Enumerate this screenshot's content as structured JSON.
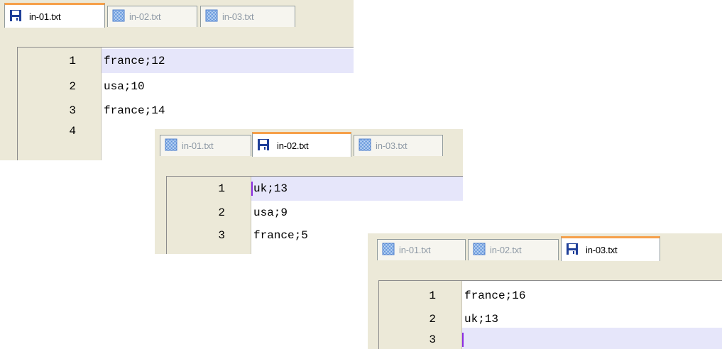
{
  "tab_labels": [
    "in-01.txt",
    "in-02.txt",
    "in-03.txt"
  ],
  "file_icon": "floppy-disk-icon",
  "panels": [
    {
      "active_tab": "in-01.txt",
      "lines": [
        {
          "num": "1",
          "text": "france;12",
          "current": true
        },
        {
          "num": "2",
          "text": "usa;10"
        },
        {
          "num": "3",
          "text": "france;14"
        },
        {
          "num": "4",
          "text": ""
        }
      ]
    },
    {
      "active_tab": "in-02.txt",
      "lines": [
        {
          "num": "1",
          "text": "uk;13",
          "current": true,
          "caret": true
        },
        {
          "num": "2",
          "text": "usa;9"
        },
        {
          "num": "3",
          "text": "france;5"
        }
      ]
    },
    {
      "active_tab": "in-03.txt",
      "lines": [
        {
          "num": "1",
          "text": "france;16"
        },
        {
          "num": "2",
          "text": "uk;13"
        },
        {
          "num": "3",
          "text": "",
          "current": true,
          "caret": true
        }
      ]
    }
  ],
  "colors": {
    "active_tab_accent": "#f6a04a",
    "current_line": "#e6e6fa",
    "caret": "#8a2be2",
    "gutter": "#ece9d8"
  }
}
